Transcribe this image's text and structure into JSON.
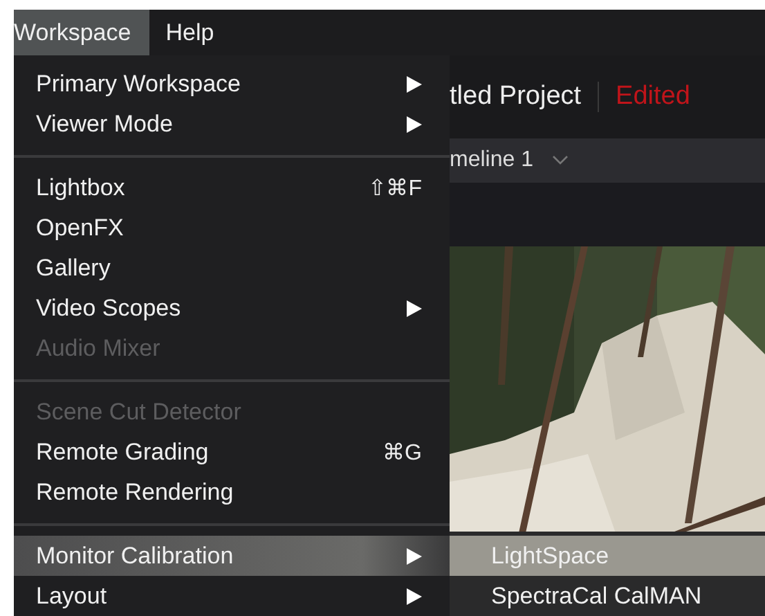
{
  "menu_bar": [
    {
      "label": "Workspace",
      "selected": true
    },
    {
      "label": "Help",
      "selected": false
    }
  ],
  "menu": {
    "items": [
      {
        "kind": "item",
        "label": "Primary Workspace",
        "submenu": true,
        "disabled": false,
        "selected": false
      },
      {
        "kind": "item",
        "label": "Viewer Mode",
        "submenu": true,
        "disabled": false,
        "selected": false
      },
      {
        "kind": "separator"
      },
      {
        "kind": "item",
        "label": "Lightbox",
        "shortcut": "⇧⌘F",
        "submenu": false,
        "disabled": false,
        "selected": false
      },
      {
        "kind": "item",
        "label": "OpenFX",
        "submenu": false,
        "disabled": false,
        "selected": false
      },
      {
        "kind": "item",
        "label": "Gallery",
        "submenu": false,
        "disabled": false,
        "selected": false
      },
      {
        "kind": "item",
        "label": "Video Scopes",
        "submenu": true,
        "disabled": false,
        "selected": false
      },
      {
        "kind": "item",
        "label": "Audio Mixer",
        "submenu": false,
        "disabled": true,
        "selected": false
      },
      {
        "kind": "separator"
      },
      {
        "kind": "item",
        "label": "Scene Cut Detector",
        "submenu": false,
        "disabled": true,
        "selected": false
      },
      {
        "kind": "item",
        "label": "Remote Grading",
        "shortcut": "⌘G",
        "submenu": false,
        "disabled": false,
        "selected": false
      },
      {
        "kind": "item",
        "label": "Remote Rendering",
        "submenu": false,
        "disabled": false,
        "selected": false
      },
      {
        "kind": "separator"
      },
      {
        "kind": "item",
        "label": "Monitor Calibration",
        "submenu": true,
        "disabled": false,
        "selected": true
      },
      {
        "kind": "item",
        "label": "Layout",
        "submenu": true,
        "disabled": false,
        "selected": false
      }
    ]
  },
  "submenu": {
    "items": [
      {
        "label": "LightSpace",
        "selected": true
      },
      {
        "label": "SpectraCal CalMAN",
        "selected": false
      }
    ]
  },
  "project": {
    "title": "tled Project",
    "status": "Edited"
  },
  "timeline": {
    "name": "meline 1"
  }
}
